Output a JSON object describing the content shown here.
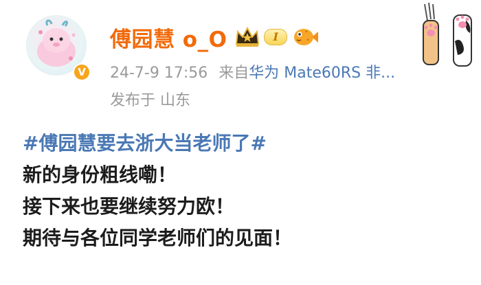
{
  "post": {
    "author_name": "傅园慧",
    "author_suffix": "o_O",
    "level_label": "I",
    "timestamp": "24-7-9 17:56",
    "source_prefix": "来自",
    "device": "华为 Mate60RS 非...",
    "location_label": "发布于 山东",
    "topic": "#傅园慧要去浙大当老师了#",
    "lines": [
      "新的身份粗线嘞！",
      "接下来也要继续努力欧！",
      "期待与各位同学老师们的见面！"
    ]
  },
  "icons": {
    "verified": "orange-verified-v-icon",
    "crown": "crown-vip-icon",
    "level": "level-badge-icon",
    "fish": "puffer-fish-icon",
    "paws": "cat-paws-decoration"
  },
  "colors": {
    "username": "#f26a0a",
    "link": "#4a78b5",
    "meta": "#9a9a9a",
    "text": "#1c1c1c",
    "verified": "#f7a51c"
  }
}
